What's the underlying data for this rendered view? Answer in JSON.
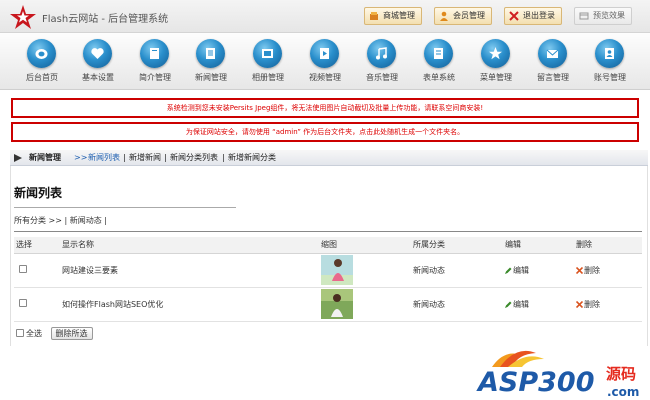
{
  "header": {
    "app_title": "Flash云网站 - 后台管理系统",
    "buttons": [
      {
        "label": "商城管理",
        "icon": "shop-icon"
      },
      {
        "label": "会员管理",
        "icon": "member-icon"
      },
      {
        "label": "退出登录",
        "icon": "logout-icon"
      },
      {
        "label": "预览效果",
        "icon": "preview-icon"
      }
    ]
  },
  "nav": {
    "items": [
      {
        "label": "后台首页",
        "icon": "home-icon"
      },
      {
        "label": "基本设置",
        "icon": "heart-icon"
      },
      {
        "label": "简介管理",
        "icon": "book-icon"
      },
      {
        "label": "新闻管理",
        "icon": "document-icon"
      },
      {
        "label": "相册管理",
        "icon": "album-icon"
      },
      {
        "label": "视频管理",
        "icon": "video-icon"
      },
      {
        "label": "音乐管理",
        "icon": "music-icon"
      },
      {
        "label": "表单系统",
        "icon": "form-icon"
      },
      {
        "label": "菜单管理",
        "icon": "star-icon"
      },
      {
        "label": "留言管理",
        "icon": "mail-icon"
      },
      {
        "label": "账号管理",
        "icon": "account-icon"
      }
    ]
  },
  "warnings": {
    "persits": "系统检测到您未安装Persits Jpeg组件，将无法使用图片自动截切及批量上传功能，请联系空间商安装!",
    "security": "为保证网站安全，请勿使用 “admin” 作为后台文件夹，点击此处随机生成一个文件夹名。"
  },
  "breadcrumb": {
    "title": "新闻管理",
    "separator": ">>",
    "links": [
      "新闻列表",
      "新增新闻",
      "新闻分类列表",
      "新增新闻分类"
    ],
    "divider": "|"
  },
  "main": {
    "title": "新闻列表",
    "category_bar": {
      "all": "所有分类",
      "sep": ">>",
      "divider": "|",
      "current": "新闻动态"
    },
    "table": {
      "headers": [
        "选择",
        "显示名称",
        "缩图",
        "所属分类",
        "编辑",
        "删除"
      ],
      "rows": [
        {
          "name": "网站建设三要素",
          "category": "新闻动态",
          "edit": "编辑",
          "delete": "删除"
        },
        {
          "name": "如何操作Flash网站SEO优化",
          "category": "新闻动态",
          "edit": "编辑",
          "delete": "删除"
        }
      ]
    },
    "footer": {
      "select_all": "全选",
      "delete_selected": "删除所选"
    }
  },
  "watermark": {
    "text": "ASP300",
    "suffix": "源码",
    "domain": ".com"
  },
  "colors": {
    "warning_red": "#cc0000",
    "link_blue": "#1e5fb0",
    "nav_ball": "#2a8fcc",
    "watermark_blue": "#1e5aa8",
    "watermark_red": "#e52b1f"
  }
}
